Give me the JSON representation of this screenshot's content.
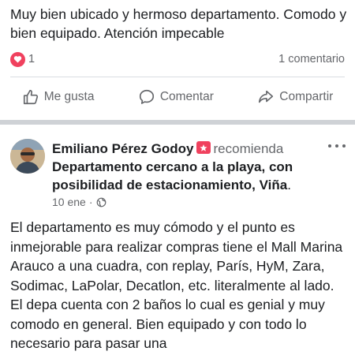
{
  "post1": {
    "text": "Muy bien ubicado y hermoso departamento. Comodo y bien equipado. Atención impecable",
    "reaction_count": "1",
    "comment_count": "1 comentario",
    "reaction_icon": "love-heart",
    "actions": {
      "like": "Me gusta",
      "comment": "Comentar",
      "share": "Compartir"
    }
  },
  "post2": {
    "author": "Emiliano Pérez Godoy",
    "recommends": "recomienda",
    "page_title": "Departamento cercano a la playa, con posibilidad de estacionamiento, Viña",
    "title_suffix": ".",
    "date": "10 ene",
    "date_separator": "·",
    "privacy_icon": "globe-icon",
    "body": "El departamento es muy cómodo y el punto es inmejorable para realizar compras tiene el Mall Marina Arauco a una cuadra, con replay, París, HyM, Zara, Sodimac, LaPolar, Decatlon, etc. literalmente al lado. El depa cuenta con 2 baños lo cual es genial y muy comodo en general. Bien equipado y con todo lo necesario para pasar una"
  },
  "colors": {
    "text": "#1c1e21",
    "secondary": "#65676b",
    "love": "#f0415e",
    "divider": "#dadde1"
  }
}
